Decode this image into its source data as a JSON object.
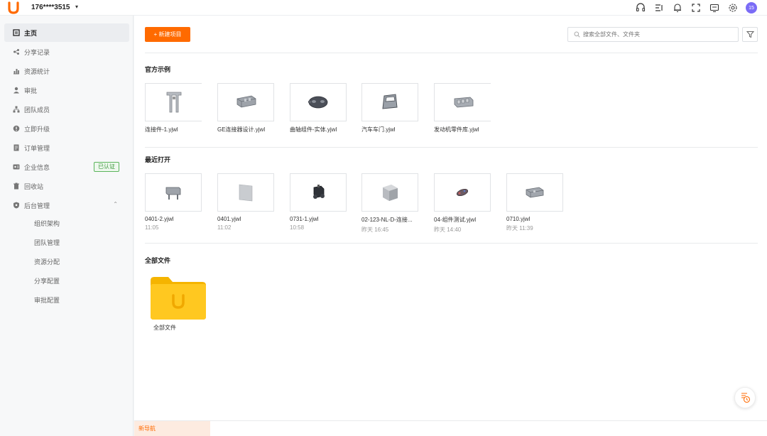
{
  "header": {
    "account": "176****3515",
    "avatar_text": "15",
    "icons": [
      "headset-icon",
      "list-icon",
      "bell-icon",
      "fullscreen-icon",
      "screen-icon",
      "gear-icon"
    ]
  },
  "sidebar": {
    "items": [
      {
        "label": "主页",
        "icon": "home-icon"
      },
      {
        "label": "分享记录",
        "icon": "share-icon"
      },
      {
        "label": "资源统计",
        "icon": "stats-icon"
      },
      {
        "label": "审批",
        "icon": "user-icon"
      },
      {
        "label": "团队成员",
        "icon": "team-icon"
      },
      {
        "label": "立即升级",
        "icon": "upgrade-icon"
      },
      {
        "label": "订单管理",
        "icon": "order-icon"
      },
      {
        "label": "企业信息",
        "icon": "enterprise-icon"
      },
      {
        "label": "回收站",
        "icon": "trash-icon"
      },
      {
        "label": "后台管理",
        "icon": "admin-icon"
      }
    ],
    "badge": "已认证",
    "sub_items": [
      "组织架构",
      "团队管理",
      "资源分配",
      "分享配置",
      "审批配置"
    ]
  },
  "toolbar": {
    "new_label": "+ 新建项目",
    "search_placeholder": "搜索全部文件、文件夹"
  },
  "sections": {
    "examples_title": "官方示例",
    "recent_title": "最近打开",
    "all_title": "全部文件"
  },
  "examples": [
    {
      "name": "连接件-1.yjwl"
    },
    {
      "name": "GE连接器设计.yjwl"
    },
    {
      "name": "曲轴组件-实体.yjwl"
    },
    {
      "name": "汽车车门.yjwl"
    },
    {
      "name": "发动机零件库.yjwl"
    }
  ],
  "recent": [
    {
      "name": "0401-2.yjwl",
      "time": "11:05"
    },
    {
      "name": "0401.yjwl",
      "time": "11:02"
    },
    {
      "name": "0731-1.yjwl",
      "time": "10:58"
    },
    {
      "name": "02-123-NL-D-连接...",
      "time": "昨天 16:45"
    },
    {
      "name": "04-组件测试.yjwl",
      "time": "昨天 14:40"
    },
    {
      "name": "0710.yjwl",
      "time": "昨天 11:39"
    }
  ],
  "all_files": {
    "folder_name": "全部文件"
  },
  "bottom": {
    "tab_label": "新导航"
  },
  "colors": {
    "accent": "#ff6a00",
    "folder": "#ffc21a",
    "avatar": "#7b6cf6"
  }
}
